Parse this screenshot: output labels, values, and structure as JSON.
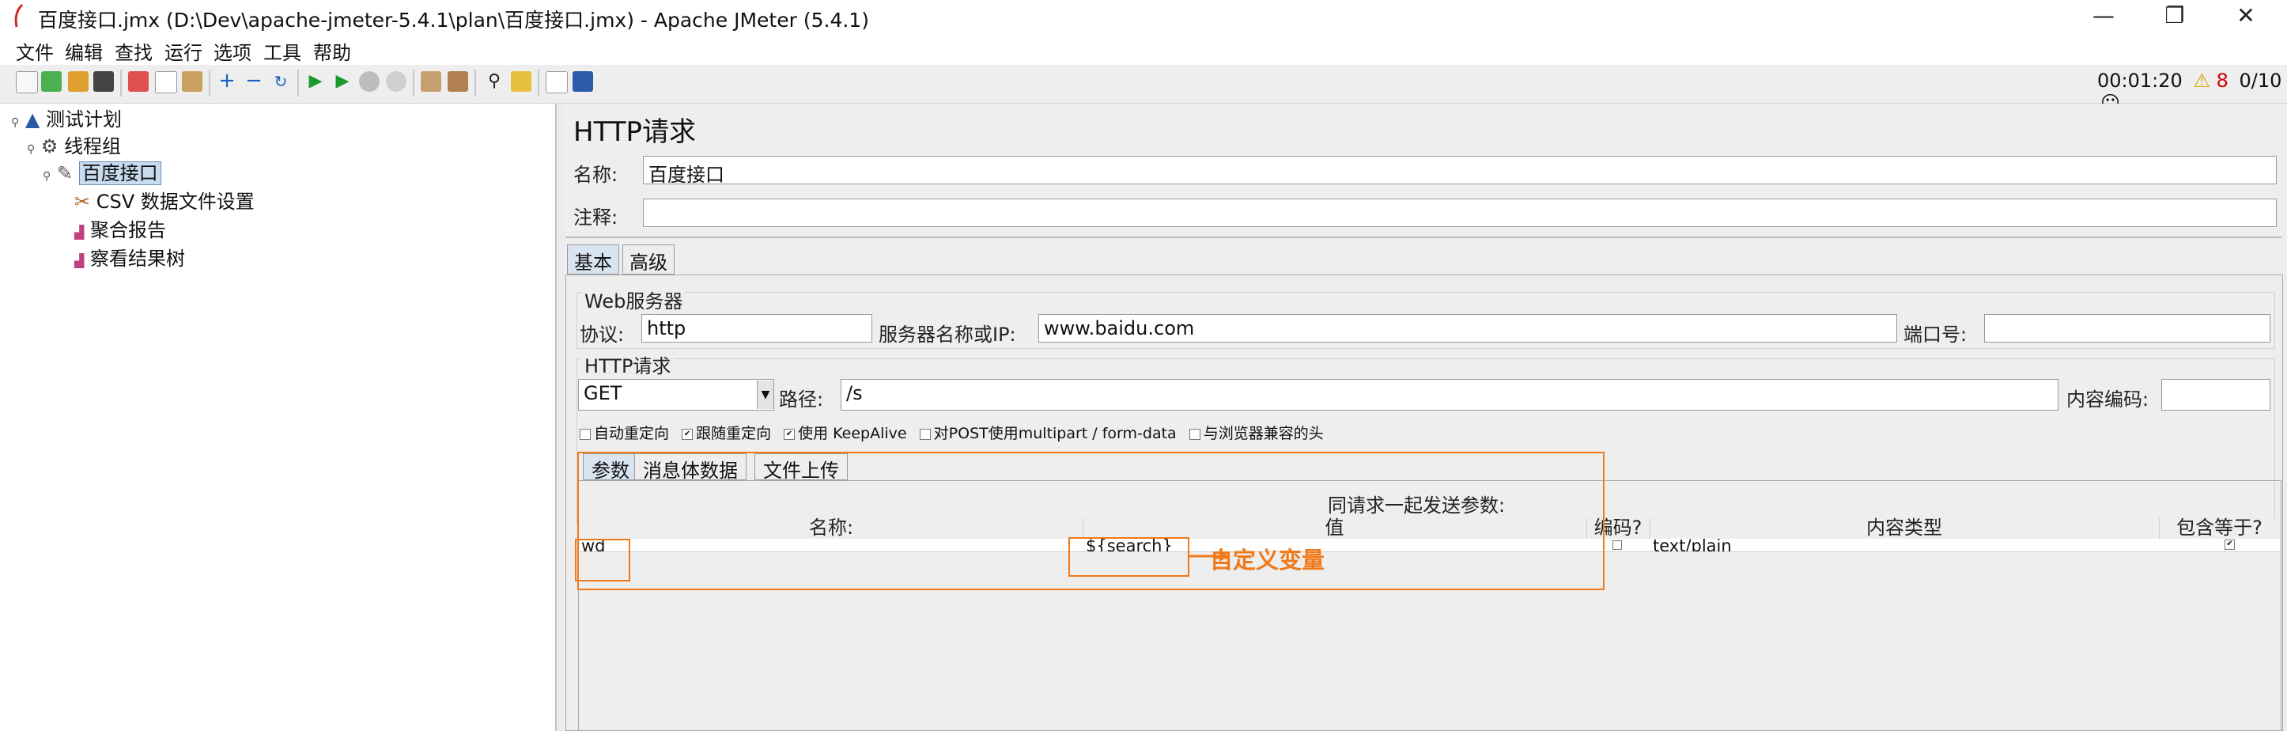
{
  "window": {
    "title": "百度接口.jmx (D:\\Dev\\apache-jmeter-5.4.1\\plan\\百度接口.jmx) - Apache JMeter (5.4.1)",
    "controls": [
      "—",
      "❐",
      "✕"
    ]
  },
  "menu": [
    "文件",
    "编辑",
    "查找",
    "运行",
    "选项",
    "工具",
    "帮助"
  ],
  "toolbar_status": {
    "time": "00:01:20",
    "warnings": "8",
    "threads": "0/10"
  },
  "tree": {
    "items": [
      {
        "label": "测试计划",
        "icon": "test-plan-icon"
      },
      {
        "label": "线程组",
        "icon": "thread-group-icon"
      },
      {
        "label": "百度接口",
        "icon": "http-sampler-icon"
      },
      {
        "label": "CSV 数据文件设置",
        "icon": "csv-config-icon"
      },
      {
        "label": "聚合报告",
        "icon": "listener-icon"
      },
      {
        "label": "察看结果树",
        "icon": "listener-icon"
      }
    ]
  },
  "panel": {
    "heading": "HTTP请求",
    "name_label": "名称:",
    "name_value": "百度接口",
    "comment_label": "注释:",
    "comment_value": "",
    "tabs": [
      "基本",
      "高级"
    ],
    "web_server_group": "Web服务器",
    "protocol_label": "协议:",
    "protocol_value": "http",
    "server_label": "服务器名称或IP:",
    "server_value": "www.baidu.com",
    "port_label": "端口号:",
    "port_value": "",
    "http_group": "HTTP请求",
    "method_value": "GET",
    "path_label": "路径:",
    "path_value": "/s",
    "encoding_label": "内容编码:",
    "encoding_value": "",
    "options": [
      {
        "label": "自动重定向",
        "checked": false
      },
      {
        "label": "跟随重定向",
        "checked": true
      },
      {
        "label": "使用 KeepAlive",
        "checked": true
      },
      {
        "label": "对POST使用multipart / form-data",
        "checked": false
      },
      {
        "label": "与浏览器兼容的头",
        "checked": false
      }
    ],
    "sub_tabs": [
      "参数",
      "消息体数据",
      "文件上传"
    ],
    "params_caption": "同请求一起发送参数:",
    "columns": [
      "名称:",
      "值",
      "编码?",
      "内容类型",
      "包含等于?"
    ],
    "rows": [
      {
        "name": "wd",
        "value": "${search}",
        "encode": false,
        "content_type": "text/plain",
        "include_equals": true
      }
    ],
    "annotation": "自定义变量",
    "accent_color": "#f07a1a"
  }
}
